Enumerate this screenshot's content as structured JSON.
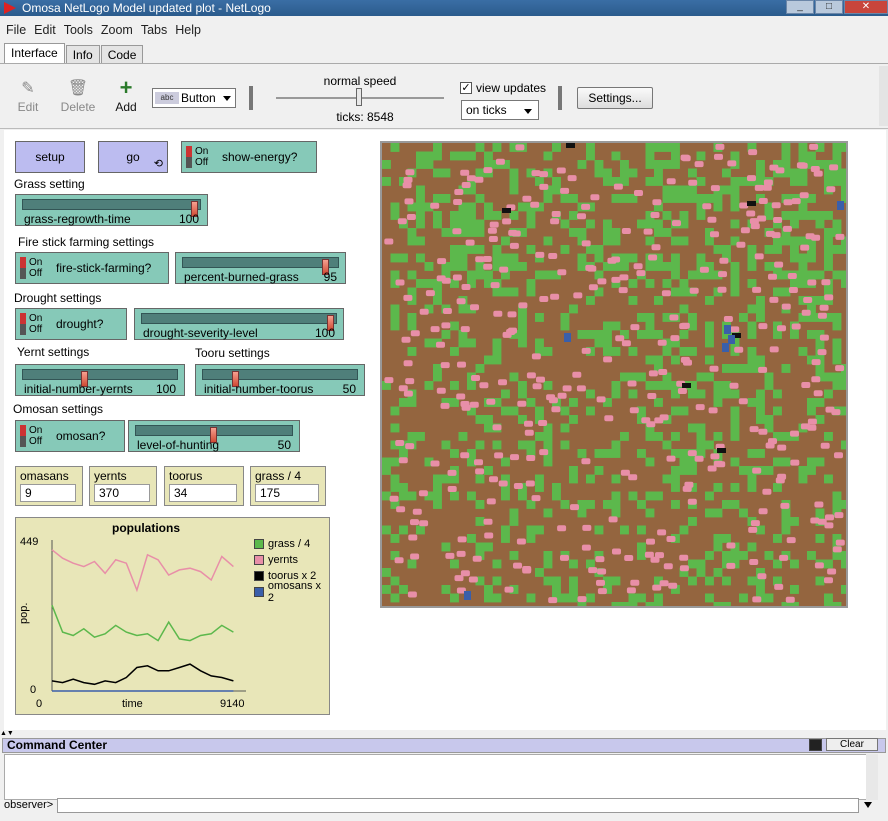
{
  "window": {
    "title": "Omosa NetLogo Model updated plot - NetLogo",
    "min": "_",
    "max": "□",
    "close": "✕"
  },
  "menu": [
    "File",
    "Edit",
    "Tools",
    "Zoom",
    "Tabs",
    "Help"
  ],
  "tabs": [
    "Interface",
    "Info",
    "Code"
  ],
  "toolbar": {
    "edit": "Edit",
    "delete": "Delete",
    "add": "Add",
    "widget_type": "Button",
    "speed_label": "normal speed",
    "ticks": "ticks: 8548",
    "view_updates": "view updates",
    "update_mode": "on ticks",
    "settings": "Settings..."
  },
  "buttons": {
    "setup": "setup",
    "go": "go"
  },
  "switches": {
    "show_energy": "show-energy?",
    "fire_stick": "fire-stick-farming?",
    "drought": "drought?",
    "omosan": "omosan?",
    "on": "On",
    "off": "Off"
  },
  "notes": {
    "grass": "Grass setting",
    "fire": "Fire stick farming settings",
    "drought": "Drought settings",
    "yernt": "Yernt settings",
    "tooru": "Tooru settings",
    "omosan": "Omosan settings"
  },
  "sliders": {
    "grass_regrowth": {
      "name": "grass-regrowth-time",
      "value": "100",
      "fraction": 1.0
    },
    "percent_burned": {
      "name": "percent-burned-grass",
      "value": "95",
      "fraction": 0.95
    },
    "drought_severity": {
      "name": "drought-severity-level",
      "value": "100",
      "fraction": 1.0
    },
    "init_yernts": {
      "name": "initial-number-yernts",
      "value": "100",
      "fraction": 0.4
    },
    "init_toorus": {
      "name": "initial-number-toorus",
      "value": "50",
      "fraction": 0.2
    },
    "level_hunting": {
      "name": "level-of-hunting",
      "value": "50",
      "fraction": 0.5
    }
  },
  "monitors": [
    {
      "name": "omasans",
      "value": "9"
    },
    {
      "name": "yernts",
      "value": "370"
    },
    {
      "name": "toorus",
      "value": "34"
    },
    {
      "name": "grass / 4",
      "value": "175"
    }
  ],
  "chart_data": {
    "type": "line",
    "title": "populations",
    "xlabel": "time",
    "ylabel": "pop.",
    "xlim": [
      0,
      9140
    ],
    "ylim": [
      0,
      449
    ],
    "x_ticks": [
      "0",
      "9140"
    ],
    "y_ticks": [
      "0",
      "449"
    ],
    "series": [
      {
        "name": "grass / 4",
        "color": "#5cb84c",
        "x": [
          0,
          500,
          1000,
          1500,
          2000,
          2500,
          3000,
          3500,
          4000,
          4500,
          5000,
          5500,
          6000,
          6500,
          7000,
          7500,
          8000,
          8548
        ],
        "y": [
          255,
          175,
          165,
          185,
          160,
          170,
          195,
          175,
          165,
          170,
          150,
          205,
          155,
          150,
          165,
          170,
          195,
          175
        ]
      },
      {
        "name": "yernts",
        "color": "#e88fa8",
        "x": [
          0,
          500,
          1000,
          1500,
          2000,
          2500,
          3000,
          3500,
          4000,
          4500,
          5000,
          5500,
          6000,
          6500,
          7000,
          7500,
          8000,
          8548
        ],
        "y": [
          420,
          395,
          380,
          370,
          385,
          350,
          390,
          380,
          300,
          405,
          390,
          345,
          360,
          365,
          355,
          330,
          400,
          370
        ]
      },
      {
        "name": "toorus x 2",
        "color": "#000000",
        "x": [
          0,
          500,
          1000,
          1500,
          2000,
          2500,
          3000,
          3500,
          4000,
          4500,
          5000,
          5500,
          6000,
          6500,
          7000,
          7500,
          8000,
          8548
        ],
        "y": [
          30,
          25,
          35,
          25,
          20,
          30,
          25,
          40,
          70,
          75,
          60,
          60,
          70,
          80,
          60,
          45,
          40,
          30
        ]
      },
      {
        "name": "omosans x 2",
        "color": "#3a5faa",
        "x": [
          0,
          8548
        ],
        "y": [
          0,
          0
        ]
      }
    ],
    "legend": "right",
    "grid": false
  },
  "world": {
    "grass_color": "#5cb84c",
    "soil_color": "#94653f",
    "yernt_color": "#e88fa8",
    "tooru_color": "#111111",
    "omosan_color": "#3a5faa"
  },
  "command_center": {
    "title": "Command Center",
    "clear": "Clear",
    "prompt": "observer>"
  }
}
